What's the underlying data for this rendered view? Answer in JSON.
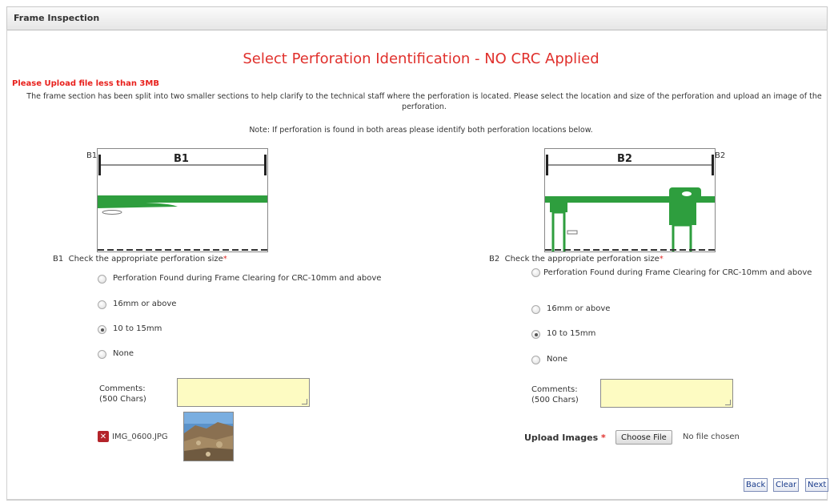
{
  "panel": {
    "title": "Frame Inspection"
  },
  "page_title": "Select Perforation Identification - NO CRC Applied",
  "upload_warning": "Please Upload file less than 3MB",
  "instructions": "The frame section has been split into two smaller sections to help clarify to the technical staff where the perforation is located. Please select the location and size of the perforation and upload an image of the perforation.",
  "note": "Note: If perforation is found in both areas please identify both perforation locations below.",
  "sections": [
    {
      "id": "B1",
      "diagram_corner_label": "B1",
      "diagram_label": "B1",
      "prompt_prefix": "B1",
      "prompt": "Check the appropriate perforation size",
      "required_marker": "*",
      "options": [
        {
          "label": "Perforation Found during Frame Clearing for CRC-10mm and above",
          "checked": false
        },
        {
          "label": "16mm or above",
          "checked": false
        },
        {
          "label": "10 to 15mm",
          "checked": true
        },
        {
          "label": "None",
          "checked": false
        }
      ],
      "comments_label": "Comments:",
      "comments_limit": "(500 Chars)",
      "comments_value": "",
      "uploaded_file": "IMG_0600.JPG"
    },
    {
      "id": "B2",
      "diagram_corner_label": "B2",
      "diagram_label": "B2",
      "prompt_prefix": "B2",
      "prompt": "Check the appropriate perforation size",
      "required_marker": "*",
      "options": [
        {
          "label": "Perforation Found during Frame Clearing for CRC-10mm and above",
          "checked": false
        },
        {
          "label": "16mm or above",
          "checked": false
        },
        {
          "label": "10 to 15mm",
          "checked": true
        },
        {
          "label": "None",
          "checked": false
        }
      ],
      "comments_label": "Comments:",
      "comments_limit": "(500 Chars)",
      "comments_value": "",
      "upload_label": "Upload Images",
      "upload_required_marker": "*",
      "choose_file_label": "Choose File",
      "no_file_text": "No file chosen"
    }
  ],
  "footer": {
    "back_label": "Back",
    "clear_label": "Clear",
    "next_label": "Next"
  },
  "colors": {
    "title_red": "#e0302c",
    "frame_green": "#2e9e3e",
    "comment_fill": "#fdfbc2"
  }
}
